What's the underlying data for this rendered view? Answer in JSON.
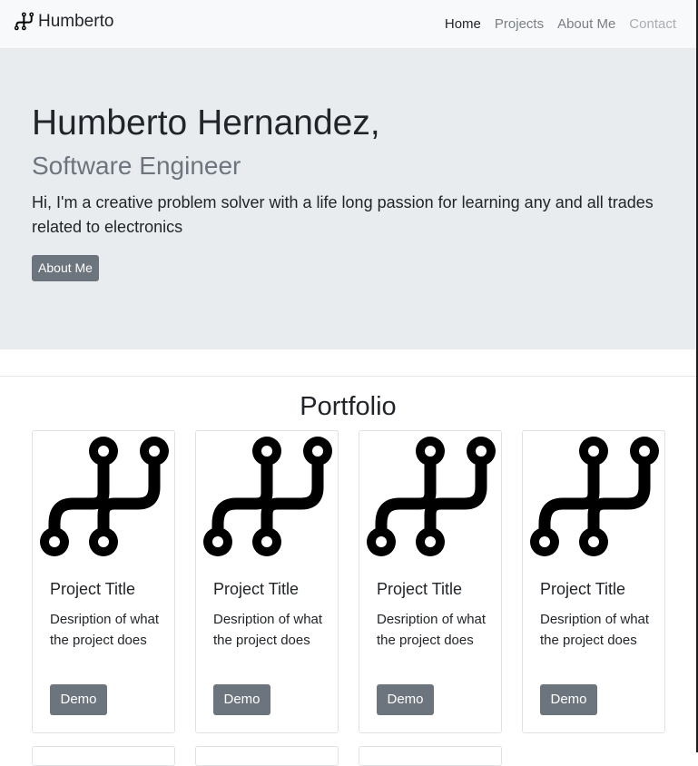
{
  "navbar": {
    "brand_icon": "circuit-logo-icon",
    "brand": "Humberto",
    "links": [
      {
        "label": "Home",
        "state": "active"
      },
      {
        "label": "Projects",
        "state": "normal"
      },
      {
        "label": "About Me",
        "state": "normal"
      },
      {
        "label": "Contact",
        "state": "disabled"
      }
    ]
  },
  "hero": {
    "name": "Humberto Hernandez,",
    "role": "Software Engineer",
    "intro": "Hi, I'm a creative problem solver with a life long passion for learning any and all trades related to electronics",
    "button": "About Me"
  },
  "portfolio": {
    "title": "Portfolio",
    "cards": [
      {
        "image_icon": "circuit-logo-icon",
        "title": "Project Title",
        "description": "Desription of what the project does",
        "button": "Demo"
      },
      {
        "image_icon": "circuit-logo-icon",
        "title": "Project Title",
        "description": "Desription of what the project does",
        "button": "Demo"
      },
      {
        "image_icon": "circuit-logo-icon",
        "title": "Project Title",
        "description": "Desription of what the project does",
        "button": "Demo"
      },
      {
        "image_icon": "circuit-logo-icon",
        "title": "Project Title",
        "description": "Desription of what the project does",
        "button": "Demo"
      }
    ]
  },
  "colors": {
    "navbar_bg": "#f8f9fa",
    "hero_bg": "#e9ecef",
    "button_bg": "#6c757d",
    "text": "#212529",
    "muted": "#6c757d"
  }
}
